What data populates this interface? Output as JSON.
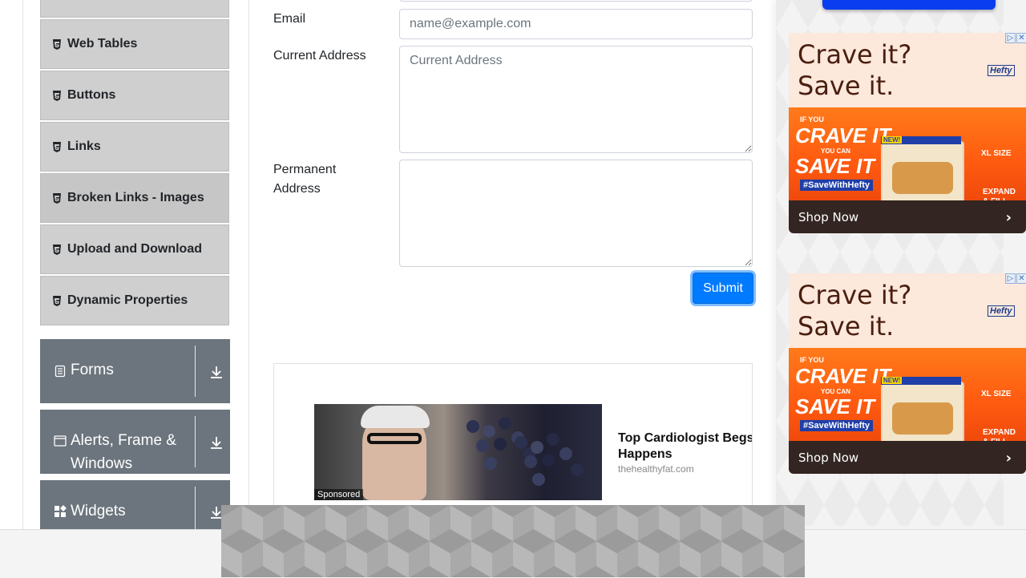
{
  "sidebar": {
    "elements_items": [
      {
        "label": ""
      },
      {
        "label": "Web Tables"
      },
      {
        "label": "Buttons"
      },
      {
        "label": "Links"
      },
      {
        "label": "Broken Links - Images"
      },
      {
        "label": "Upload and Download"
      },
      {
        "label": "Dynamic Properties"
      }
    ],
    "groups": [
      {
        "label": "Forms",
        "icon": "document-icon"
      },
      {
        "label": "Alerts, Frame & Windows",
        "icon": "window-icon"
      },
      {
        "label": "Widgets",
        "icon": "widgets-icon"
      }
    ]
  },
  "form": {
    "email_label": "Email",
    "email_placeholder": "name@example.com",
    "email_value": "",
    "current_address_label": "Current Address",
    "current_address_placeholder": "Current Address",
    "permanent_address_label": "Permanent Address",
    "permanent_address_placeholder": "",
    "submit_label": "Submit"
  },
  "sponsored_card": {
    "sponsored_badge": "Sponsored",
    "headline": "Top Cardiologist Begs: Quit Eating This Before It Happens",
    "headline_visible": "Top Cardiologist Begs: Qu",
    "headline_line2": "Happens",
    "source": "thehealthyfat.com"
  },
  "right_ads": [
    {
      "title": "Crave it? Save it.",
      "brand": "Hefty",
      "image_text": {
        "line1": "IF YOU",
        "line2": "CRAVE IT",
        "line3": "YOU CAN",
        "line4": "SAVE IT",
        "tag": "#SaveWithHefty",
        "size": "XL SIZE",
        "expand": "EXPAND & FILL",
        "new": "NEW!"
      },
      "cta": "Shop Now"
    },
    {
      "title": "Crave it? Save it.",
      "brand": "Hefty",
      "image_text": {
        "line1": "IF YOU",
        "line2": "CRAVE IT",
        "line3": "YOU CAN",
        "line4": "SAVE IT",
        "tag": "#SaveWithHefty",
        "size": "XL SIZE",
        "expand": "EXPAND & FILL",
        "new": "NEW!"
      },
      "cta": "Shop Now"
    }
  ],
  "colors": {
    "accent": "#007bff",
    "group_bg": "#6c757d",
    "menu_bg": "#cfcfcf"
  }
}
